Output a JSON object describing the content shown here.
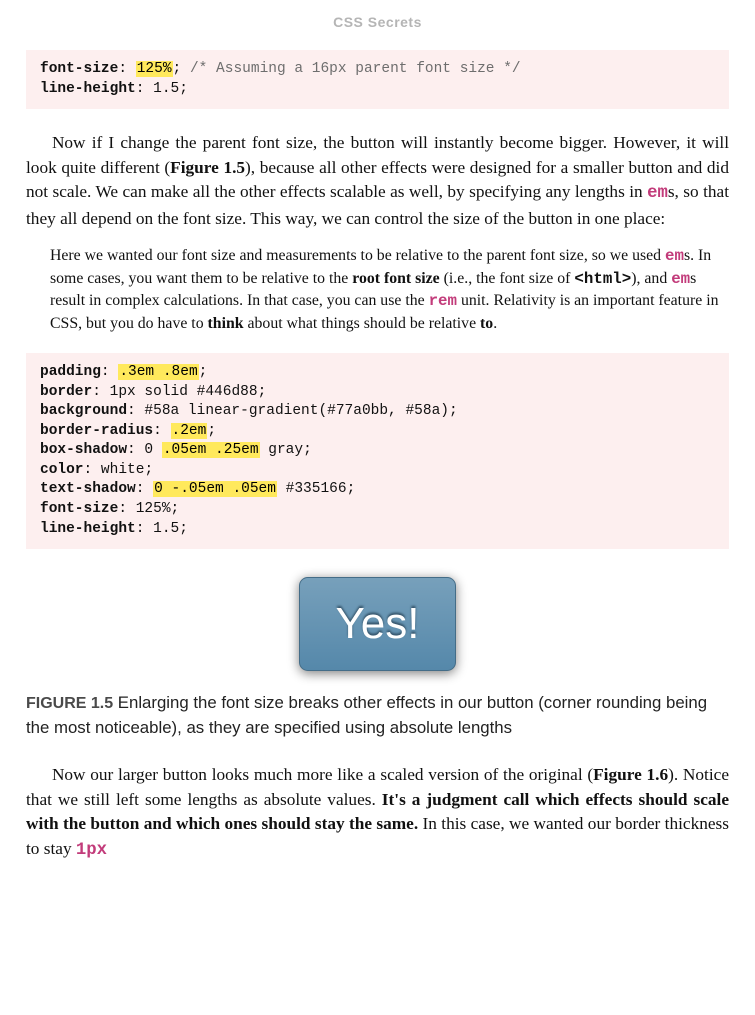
{
  "header": {
    "title": "CSS Secrets"
  },
  "code1": {
    "line1": {
      "prop": "font-size",
      "value": "125%",
      "comment": "/* Assuming a 16px parent font size */"
    },
    "line2": {
      "prop": "line-height",
      "value": "1.5"
    }
  },
  "para1": {
    "t1": "Now if I change the parent font size, the button will instantly become bigger. However, it will look quite different (",
    "figref": "Figure 1.5",
    "t2": "), because all other effects were designed for a smaller button and did not scale. We can make all the other effects scalable as well, by specifying any lengths in ",
    "em_unit": "em",
    "t3": "s, so that they all depend on the font size. This way, we can control the size of the button in one place:"
  },
  "note": {
    "t1": "Here we wanted our font size and measurements to be relative to the parent font size, so we used ",
    "em_unit": "em",
    "t2": "s. In some cases, you want them to be relative to the ",
    "rootfs": "root font size",
    "t3": " (i.e., the font size of ",
    "html_tag": "<html>",
    "t4": "), and ",
    "t5": "s result in complex calculations. In that case, you can use the ",
    "rem_unit": "rem",
    "t6": " unit. Relativity is an important feature in CSS, but you do have to ",
    "think": "think",
    "t7": " about what things should be relative ",
    "to": "to",
    "t8": "."
  },
  "code2": {
    "padding": {
      "prop": "padding",
      "hi": ".3em .8em"
    },
    "border": {
      "prop": "border",
      "rest": "1px solid #446d88"
    },
    "background": {
      "prop": "background",
      "rest": "#58a linear-gradient(#77a0bb, #58a)"
    },
    "bradius": {
      "prop": "border-radius",
      "hi": ".2em"
    },
    "bshadow": {
      "prop": "box-shadow",
      "pre": "0 ",
      "hi": ".05em .25em",
      "post": " gray"
    },
    "color": {
      "prop": "color",
      "rest": "white"
    },
    "tshadow": {
      "prop": "text-shadow",
      "hi": "0 -.05em .05em",
      "post": " #335166"
    },
    "fsize": {
      "prop": "font-size",
      "rest": "125%"
    },
    "lheight": {
      "prop": "line-height",
      "rest": "1.5"
    }
  },
  "button": {
    "label": "Yes!"
  },
  "figcap": {
    "label": "FIGURE 1.5",
    "text": " Enlarging the font size breaks other effects in our button (corner rounding being the most noticeable), as they are specified using absolute lengths"
  },
  "para2": {
    "t1": "Now our larger button looks much more like a scaled version of the original (",
    "figref": "Figure 1.6",
    "t2": "). Notice that we still left some lengths as absolute values. ",
    "bold": "It's a judgment call which effects should scale with the button and which ones should stay the same.",
    "t3": " In this case, we wanted our border thickness to stay ",
    "onepx": "1px"
  }
}
